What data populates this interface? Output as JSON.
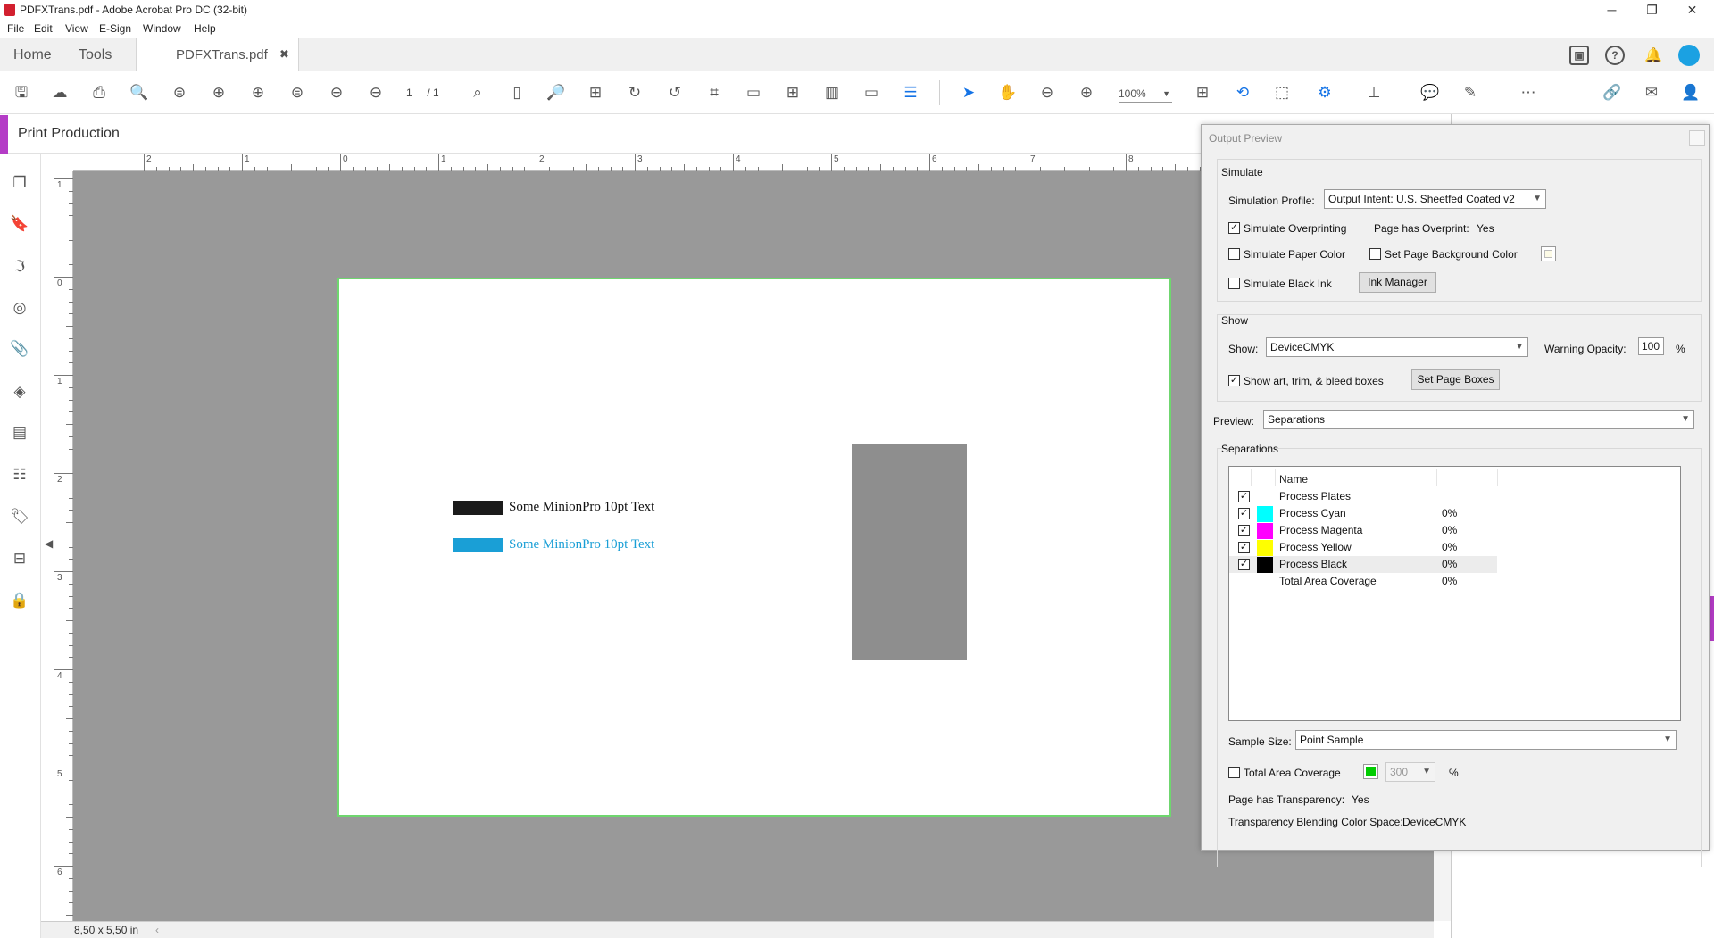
{
  "window": {
    "title": "PDFXTrans.pdf - Adobe Acrobat Pro DC (32-bit)",
    "minimize": "─",
    "maximize": "❐",
    "close": "✕"
  },
  "menu": [
    "File",
    "Edit",
    "View",
    "E-Sign",
    "Window",
    "Help"
  ],
  "tabs": {
    "home": "Home",
    "tools": "Tools",
    "document": "PDFXTrans.pdf",
    "document_close": "✖"
  },
  "toolbar": {
    "page_current": "1",
    "page_total": "/  1",
    "zoom": "100%"
  },
  "panel": {
    "title": "Print Production"
  },
  "rulers": {
    "top": [
      "2",
      "1",
      "0",
      "1",
      "2",
      "3",
      "4",
      "5",
      "6",
      "7",
      "8"
    ],
    "left": [
      "1",
      "0",
      "1",
      "2",
      "3",
      "4",
      "5",
      "6"
    ]
  },
  "page": {
    "line1": "Some MinionPro 10pt Text",
    "line2": "Some MinionPro 10pt Text",
    "line2_color": "#1a9fd6"
  },
  "status": {
    "size": "8,50 x 5,50 in"
  },
  "dialog": {
    "title": "Output Preview",
    "simulate": {
      "heading": "Simulate",
      "profile_label": "Simulation Profile:",
      "profile_value": "Output Intent: U.S. Sheetfed Coated v2",
      "overprinting": "Simulate Overprinting",
      "overprinting_checked": true,
      "overprint_label": "Page has Overprint:",
      "overprint_value": "Yes",
      "paper_color": "Simulate Paper Color",
      "paper_color_checked": false,
      "page_bg": "Set Page Background Color",
      "page_bg_checked": false,
      "black_ink": "Simulate Black Ink",
      "black_ink_checked": false,
      "ink_manager": "Ink Manager"
    },
    "show": {
      "heading": "Show",
      "show_label": "Show:",
      "show_value": "DeviceCMYK",
      "warning_label": "Warning Opacity:",
      "warning_value": "100",
      "warning_unit": "%",
      "boxes_label": "Show art, trim, & bleed boxes",
      "boxes_checked": true,
      "set_page_boxes": "Set Page Boxes"
    },
    "preview": {
      "label": "Preview:",
      "value": "Separations"
    },
    "separations": {
      "heading": "Separations",
      "col_name": "Name",
      "rows": [
        {
          "name": "Process Plates",
          "value": "",
          "color": "",
          "checked": true
        },
        {
          "name": "Process Cyan",
          "value": "0%",
          "color": "#00ffff",
          "checked": true
        },
        {
          "name": "Process Magenta",
          "value": "0%",
          "color": "#ff00ff",
          "checked": true
        },
        {
          "name": "Process Yellow",
          "value": "0%",
          "color": "#ffff00",
          "checked": true
        },
        {
          "name": "Process Black",
          "value": "0%",
          "color": "#000000",
          "checked": true
        },
        {
          "name": "Total Area Coverage",
          "value": "0%",
          "color": "",
          "checked": false
        }
      ]
    },
    "sample": {
      "label": "Sample Size:",
      "value": "Point Sample"
    },
    "tac": {
      "label": "Total Area Coverage",
      "checked": false,
      "value": "300",
      "unit": "%",
      "color": "#00cc00"
    },
    "transparency": {
      "label": "Page has Transparency:",
      "value": "Yes",
      "blend_label": "Transparency Blending Color Space:",
      "blend_value": "DeviceCMYK"
    }
  }
}
